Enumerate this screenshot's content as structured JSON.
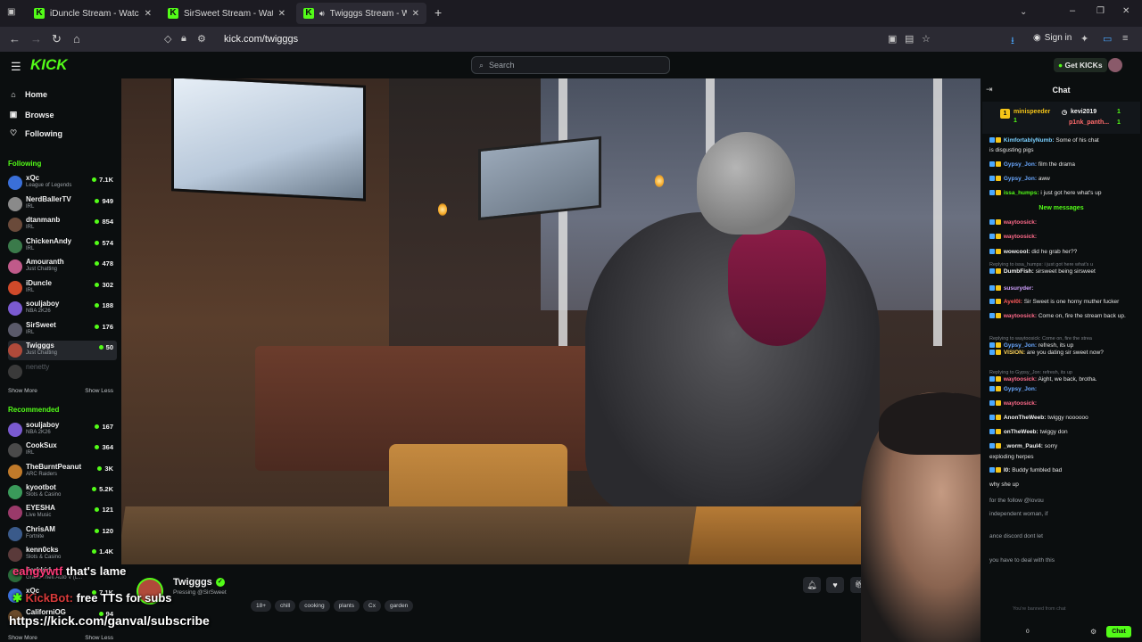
{
  "browser": {
    "tabs": [
      {
        "title": "iDuncle Stream - Watch Live on",
        "active": false
      },
      {
        "title": "SirSweet Stream - Watch Live on",
        "active": false
      },
      {
        "title": "Twigggs Stream - Watch Live",
        "active": true
      }
    ],
    "url": "kick.com/twigggs",
    "sign_in": "Sign in"
  },
  "header": {
    "logo": "KICK",
    "search_placeholder": "Search",
    "get_kicks": "Get KICKs"
  },
  "sidebar": {
    "nav": [
      {
        "label": "Home",
        "icon": "home-icon"
      },
      {
        "label": "Browse",
        "icon": "browse-icon"
      },
      {
        "label": "Following",
        "icon": "heart-icon"
      }
    ],
    "following_title": "Following",
    "following": [
      {
        "name": "xQc",
        "category": "League of Legends",
        "viewers": "7.1K",
        "color": "#3a6fd8"
      },
      {
        "name": "NerdBallerTV",
        "category": "IRL",
        "viewers": "949",
        "color": "#8a8a8a"
      },
      {
        "name": "dtanmanb",
        "category": "IRL",
        "viewers": "854",
        "color": "#6a4a3a"
      },
      {
        "name": "ChickenAndy",
        "category": "IRL",
        "viewers": "574",
        "color": "#3a7a4a"
      },
      {
        "name": "Amouranth",
        "category": "Just Chatting",
        "viewers": "478",
        "color": "#c05a8a"
      },
      {
        "name": "iDuncle",
        "category": "IRL",
        "viewers": "302",
        "color": "#d04a2a"
      },
      {
        "name": "souljaboy",
        "category": "NBA 2K26",
        "viewers": "188",
        "color": "#7a5ad0"
      },
      {
        "name": "SirSweet",
        "category": "IRL",
        "viewers": "176",
        "color": "#5a5a6a"
      },
      {
        "name": "Twigggs",
        "category": "Just Chatting",
        "viewers": "50",
        "color": "#b04a3a"
      },
      {
        "name": "nenetty",
        "category": "",
        "viewers": "",
        "color": "#3a3a3a"
      }
    ],
    "show_more": "Show More",
    "show_less": "Show Less",
    "recommended_title": "Recommended",
    "recommended": [
      {
        "name": "souljaboy",
        "category": "NBA 2K26",
        "viewers": "167",
        "color": "#7a5ad0"
      },
      {
        "name": "CookSux",
        "category": "IRL",
        "viewers": "364",
        "color": "#4a4a4a"
      },
      {
        "name": "TheBurntPeanut",
        "category": "ARC Raiders",
        "viewers": "3K",
        "color": "#c07a2a"
      },
      {
        "name": "kyootbot",
        "category": "Slots & Casino",
        "viewers": "5.2K",
        "color": "#3a9a5a"
      },
      {
        "name": "EYESHA",
        "category": "Live Music",
        "viewers": "121",
        "color": "#9a3a6a"
      },
      {
        "name": "ChrisAM",
        "category": "Fortnite",
        "viewers": "120",
        "color": "#3a5a8a"
      },
      {
        "name": "kenn0cks",
        "category": "Slots & Casino",
        "viewers": "1.4K",
        "color": "#5a3a3a"
      },
      {
        "name": "Jerkkid",
        "category": "Grand Theft Auto V (L...",
        "viewers": "",
        "color": "#2a6a3a"
      },
      {
        "name": "xQc",
        "category": "",
        "viewers": "7.1K",
        "color": "#3a6fd8"
      },
      {
        "name": "CaliforniOG",
        "category": "",
        "viewers": "94",
        "color": "#6a4a2a"
      }
    ]
  },
  "stream": {
    "streamer": "Twigggs",
    "category": "Pressing @SirSweet",
    "tags": [
      "18+",
      "chill",
      "cooking",
      "plants",
      "Cx",
      "garden"
    ],
    "gift_label": "Gi"
  },
  "overlay": {
    "line1_user": "eahgywtf",
    "line1_text": "that's lame",
    "line2_user": "KickBot:",
    "line2_text": "free TTS for subs",
    "line3_text": "https://kick.com/ganval/subscribe"
  },
  "chat": {
    "title": "Chat",
    "pinned": [
      {
        "user": "minispeeder",
        "count": "1",
        "color": "#f5c518"
      },
      {
        "user": "kevi2019",
        "count": "1",
        "color": "#ffffff"
      },
      {
        "user": "p1nk_panth...",
        "count": "1",
        "color": "#ff6a6a"
      }
    ],
    "new_messages": "New messages",
    "messages": [
      {
        "reply": "",
        "user": "KimfortablyNumb:",
        "text": "Some of his chat",
        "color": "#7ad0ff"
      },
      {
        "reply": "",
        "user": "",
        "text": "is disgusting pigs",
        "color": "#e6e6e6"
      },
      {
        "reply": "",
        "user": "Gypsy_Jon:",
        "text": "film the drama",
        "color": "#6aa8ff"
      },
      {
        "reply": "",
        "user": "Gypsy_Jon:",
        "text": "aww",
        "color": "#6aa8ff"
      },
      {
        "reply": "",
        "user": "issa_humps:",
        "text": "i just got here what's up",
        "color": "#53fc18"
      },
      {
        "reply": "",
        "user": "waytoosick:",
        "text": "",
        "color": "#ff6a8a"
      },
      {
        "reply": "",
        "user": "waytoosick:",
        "text": "",
        "color": "#ff6a8a"
      },
      {
        "reply": "",
        "user": "wowcool:",
        "text": "did he grab her??",
        "color": "#f2f2f2"
      },
      {
        "reply": "Replying to issa_humps: i just got here what's u",
        "user": "DumbFish:",
        "text": "sirsweet being sirsweet",
        "color": "#f2f2f2"
      },
      {
        "reply": "",
        "user": "susuryder:",
        "text": "",
        "color": "#d0a0ff"
      },
      {
        "reply": "",
        "user": "Ayel0l:",
        "text": "Sir Sweet is one horny muther fucker",
        "color": "#ff5a5a"
      },
      {
        "reply": "",
        "user": "waytoosick:",
        "text": "Come on, fire the stream back up.",
        "color": "#ff6a8a"
      },
      {
        "reply": "Replying to waytoosick: Come on, fire the strea",
        "user": "Gypsy_Jon:",
        "text": "refresh, its up",
        "color": "#6aa8ff"
      },
      {
        "reply": "",
        "user": "VISION:",
        "text": "are you dating sir sweet now?",
        "color": "#ffd45a"
      },
      {
        "reply": "Replying to Gypsy_Jon: refresh, its up",
        "user": "waytoosick:",
        "text": "Aight, we back, brotha.",
        "color": "#ff6a8a"
      },
      {
        "reply": "",
        "user": "Gypsy_Jon:",
        "text": "",
        "color": "#6aa8ff"
      },
      {
        "reply": "",
        "user": "waytoosick:",
        "text": "",
        "color": "#ff6a8a"
      },
      {
        "reply": "",
        "user": "AnonTheWeeb:",
        "text": "twiggy noooooo",
        "color": "#f2f2f2"
      },
      {
        "reply": "",
        "user": "onTheWeeb:",
        "text": "twiggy don",
        "color": "#f2f2f2"
      },
      {
        "reply": "",
        "user": "_worm_Paul4:",
        "text": "sorry",
        "color": "#f2f2f2"
      },
      {
        "reply": "",
        "user": "",
        "text": "exploding herpes",
        "color": "#e6e6e6"
      },
      {
        "reply": "",
        "user": "l0:",
        "text": "Buddy fumbled bad",
        "color": "#f2f2f2"
      },
      {
        "reply": "",
        "user": "",
        "text": "why she up",
        "color": "#e6e6e6"
      },
      {
        "reply": "",
        "user": "",
        "text": "for the follow @lovou",
        "color": "#9aa0a6"
      },
      {
        "reply": "",
        "user": "",
        "text": "independent woman, if",
        "color": "#9aa0a6"
      },
      {
        "reply": "",
        "user": "",
        "text": "ance discord dont let",
        "color": "#9aa0a6"
      },
      {
        "reply": "",
        "user": "",
        "text": "you have to deal with this",
        "color": "#9aa0a6"
      }
    ],
    "input_placeholder": "You're banned from chat",
    "count": "0",
    "send": "Chat"
  }
}
